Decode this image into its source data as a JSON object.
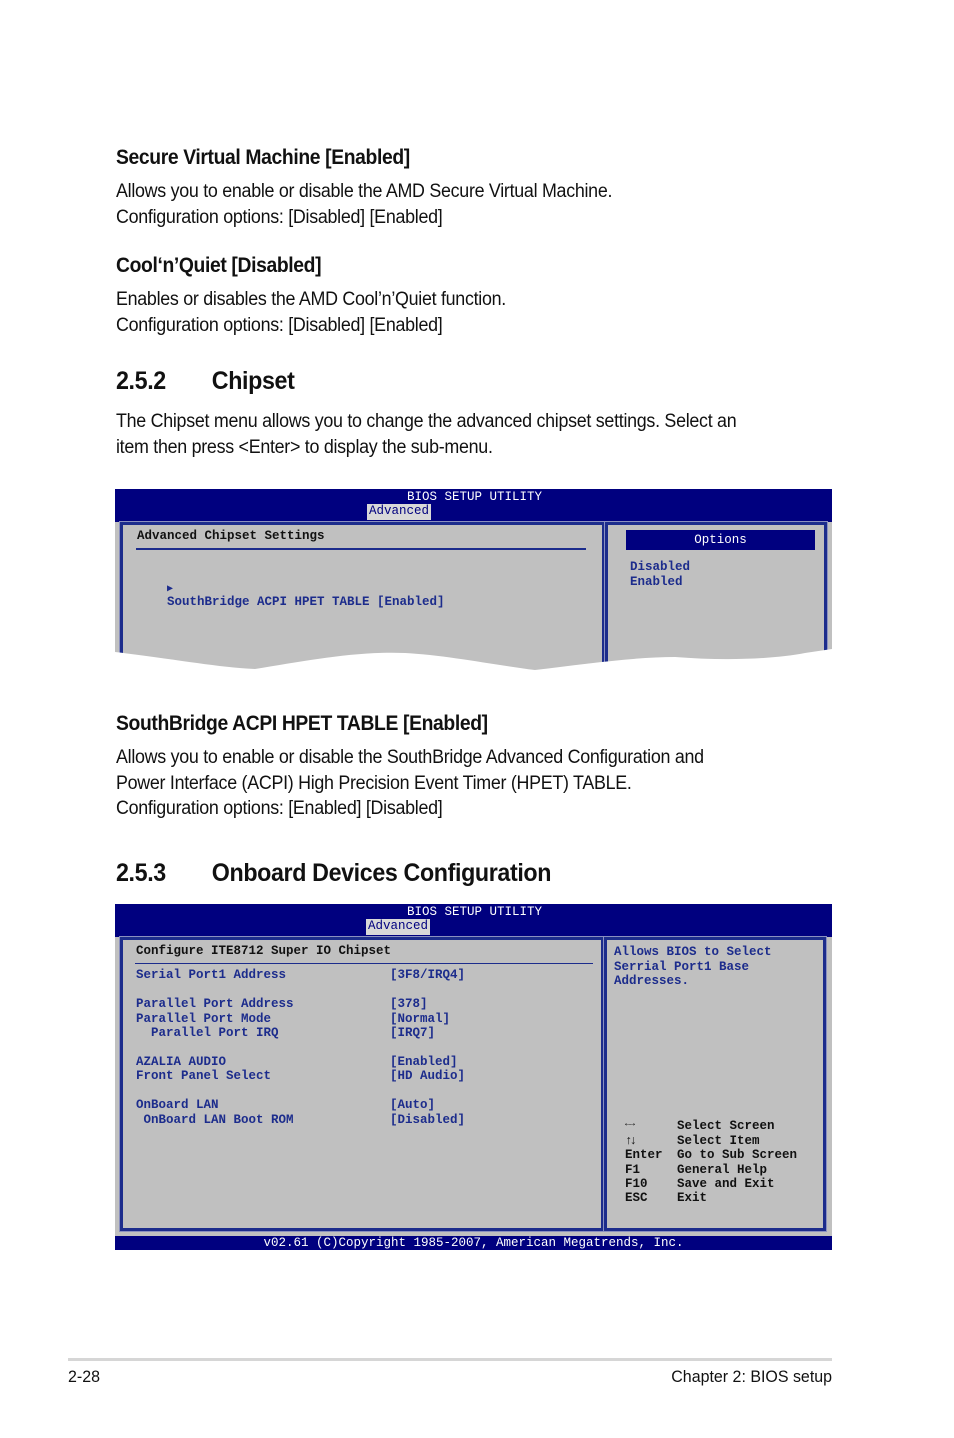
{
  "sections": {
    "svm": {
      "heading": "Secure Virtual Machine [Enabled]",
      "line1": "Allows you to enable or disable the AMD Secure Virtual Machine.",
      "line2": "Configuration options: [Disabled] [Enabled]"
    },
    "cnq": {
      "heading": "Cool‘n’Quiet [Disabled]",
      "line1": "Enables or disables the AMD Cool’n’Quiet function.",
      "line2": "Configuration options: [Disabled] [Enabled]"
    },
    "chipset": {
      "number": "2.5.2",
      "title": "Chipset",
      "line1": "The Chipset menu allows you to change the advanced chipset settings. Select an",
      "line2": "item then press <Enter> to display the sub-menu."
    },
    "hpet": {
      "heading": "SouthBridge ACPI HPET TABLE [Enabled]",
      "line1": "Allows you to enable or disable the SouthBridge Advanced Configuration and",
      "line2": "Power Interface (ACPI) High Precision Event Timer (HPET) TABLE.",
      "line3": "Configuration options: [Enabled] [Disabled]"
    },
    "onboard": {
      "number": "2.5.3",
      "title": "Onboard Devices Configuration"
    }
  },
  "bios1": {
    "title": "BIOS SETUP UTILITY",
    "tab": "Advanced",
    "panel_title": "Advanced Chipset Settings",
    "item_arrow": "▶",
    "item": "SouthBridge ACPI HPET TABLE [Enabled]",
    "options_header": "Options",
    "options": [
      "Disabled",
      "Enabled"
    ]
  },
  "bios2": {
    "title": "BIOS SETUP UTILITY",
    "tab": "Advanced",
    "panel_title": "Configure ITE8712 Super IO Chipset",
    "items": [
      {
        "label": "Serial Port1 Address",
        "value": "[3F8/IRQ4]"
      },
      {
        "label": "Parallel Port Address",
        "value": "[378]"
      },
      {
        "label": "Parallel Port Mode",
        "value": "[Normal]"
      },
      {
        "label": "  Parallel Port IRQ",
        "value": "[IRQ7]"
      },
      {
        "label": "AZALIA AUDIO",
        "value": "[Enabled]"
      },
      {
        "label": "Front Panel Select",
        "value": "[HD Audio]"
      },
      {
        "label": "OnBoard LAN",
        "value": "[Auto]"
      },
      {
        "label": " OnBoard LAN Boot ROM",
        "value": "[Disabled]"
      }
    ],
    "help": [
      "Allows BIOS to Select",
      "Serrial Port1 Base",
      "Addresses."
    ],
    "keys": [
      {
        "key": "←→",
        "action": "Select Screen"
      },
      {
        "key": "↑↓",
        "action": "Select Item"
      },
      {
        "key": "Enter",
        "action": "Go to Sub Screen"
      },
      {
        "key": "F1",
        "action": "General Help"
      },
      {
        "key": "F10",
        "action": "Save and Exit"
      },
      {
        "key": "ESC",
        "action": "Exit"
      }
    ],
    "copyright": "v02.61 (C)Copyright 1985-2007, American Megatrends, Inc."
  },
  "footer": {
    "page": "2-28",
    "chapter": "Chapter 2: BIOS setup"
  }
}
